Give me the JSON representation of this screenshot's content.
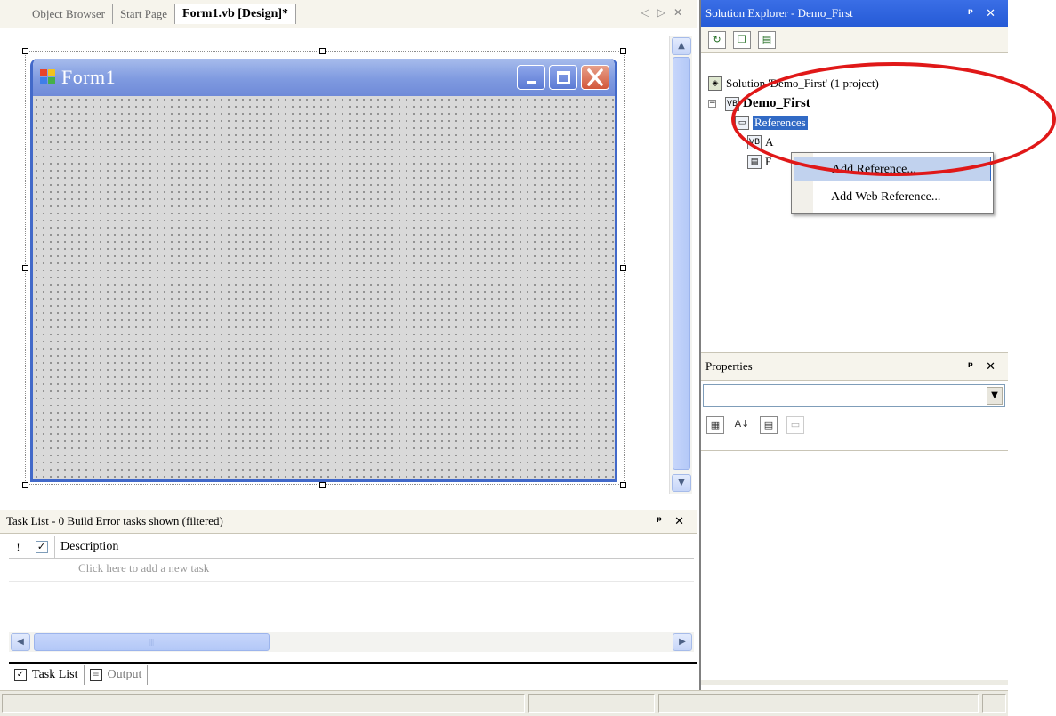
{
  "doc_tabs": {
    "tabs": [
      {
        "label": "Object Browser"
      },
      {
        "label": "Start Page"
      },
      {
        "label": "Form1.vb [Design]*"
      }
    ],
    "nav_prev": "◁",
    "nav_next": "▷",
    "close": "✕"
  },
  "form": {
    "title": "Form1"
  },
  "task_list": {
    "title": "Task List - 0 Build Error tasks shown (filtered)",
    "columns": {
      "priority": "!",
      "checked": "✓",
      "description": "Description"
    },
    "new_task_hint": "Click here to add a new task"
  },
  "bottom_tabs": [
    {
      "label": "Task List"
    },
    {
      "label": "Output"
    }
  ],
  "solution_explorer": {
    "title": "Solution Explorer - Demo_First",
    "pin": "ᵖ",
    "close": "✕",
    "tree": {
      "solution": "Solution 'Demo_First' (1 project)",
      "project": "Demo_First",
      "references": "References",
      "assembly_partial": "A",
      "form_partial": "F"
    }
  },
  "context_menu": {
    "items": [
      {
        "label": "Add Reference..."
      },
      {
        "label": "Add Web Reference..."
      }
    ]
  },
  "properties": {
    "title": "Properties",
    "object_value": ""
  },
  "colors": {
    "accent_blue": "#255ad6",
    "highlight_red": "#e01818",
    "selection": "#316ac5"
  }
}
